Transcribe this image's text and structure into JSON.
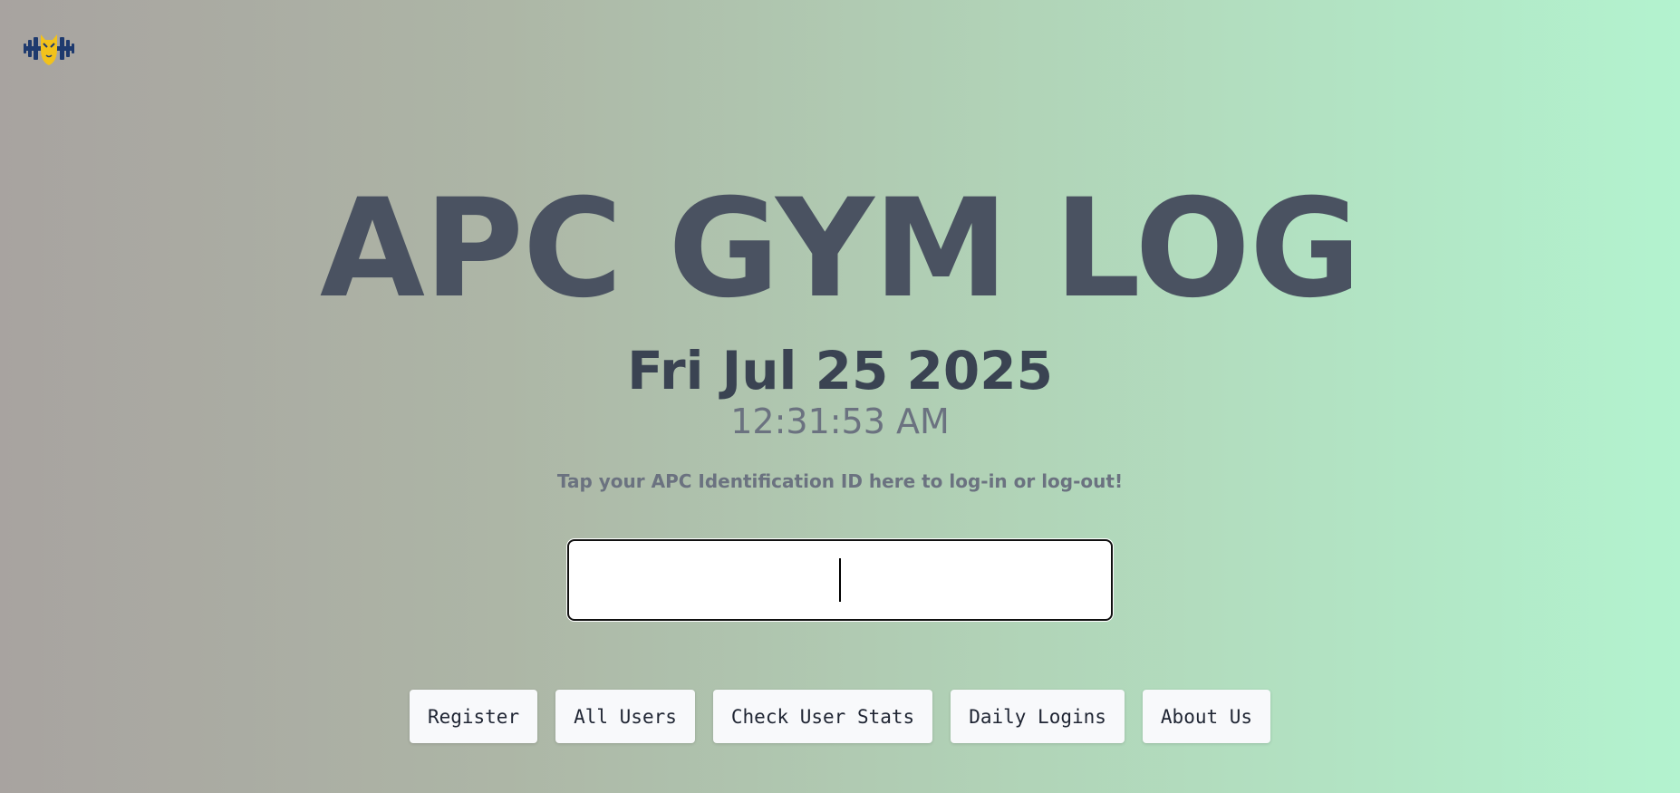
{
  "header": {
    "logo_icon": "gym-dumbbell-mascot-icon"
  },
  "main": {
    "title": "APC GYM LOG",
    "date": "Fri Jul 25 2025",
    "time": "12:31:53 AM",
    "hint": "Tap your APC Identification ID here to log-in or log-out!",
    "id_input": {
      "value": "",
      "placeholder": ""
    }
  },
  "nav": {
    "buttons": [
      {
        "label": "Register"
      },
      {
        "label": "All Users"
      },
      {
        "label": "Check User Stats"
      },
      {
        "label": "Daily Logins"
      },
      {
        "label": "About Us"
      }
    ]
  },
  "colors": {
    "title": "#4a5261",
    "date": "#3a4352",
    "muted_text": "#6b7280",
    "logo_navy": "#1e3a6e",
    "logo_gold": "#f2c21b"
  }
}
